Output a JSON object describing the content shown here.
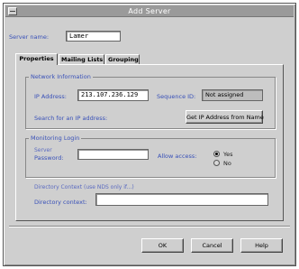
{
  "window": {
    "title": "Add Server"
  },
  "server_name": {
    "label": "Server name:",
    "value": "Lamer"
  },
  "tabs": [
    {
      "label": "Properties",
      "active": true
    },
    {
      "label": "Mailing Lists",
      "active": false
    },
    {
      "label": "Grouping",
      "active": false
    }
  ],
  "network": {
    "group_title": "Network Information",
    "ip_label": "IP Address:",
    "ip_value": "213.107.236.129",
    "sequence_label": "Sequence ID:",
    "sequence_value": "Not assigned",
    "search_label": "Search for an IP address:",
    "get_ip_button": "Get IP Address from Name"
  },
  "monitoring": {
    "group_title": "Monitoring Login",
    "name_label": "Server",
    "password_label": "Password:",
    "name_value": "",
    "password_value": "",
    "allow_label": "Allow access:",
    "yes_label": "Yes",
    "no_label": "No",
    "selected": "Yes",
    "directory_note": "Directory Context (use NDS only if...)",
    "directory_label": "Directory context:",
    "directory_value": ""
  },
  "buttons": {
    "ok": "OK",
    "cancel": "Cancel",
    "help": "Help"
  }
}
